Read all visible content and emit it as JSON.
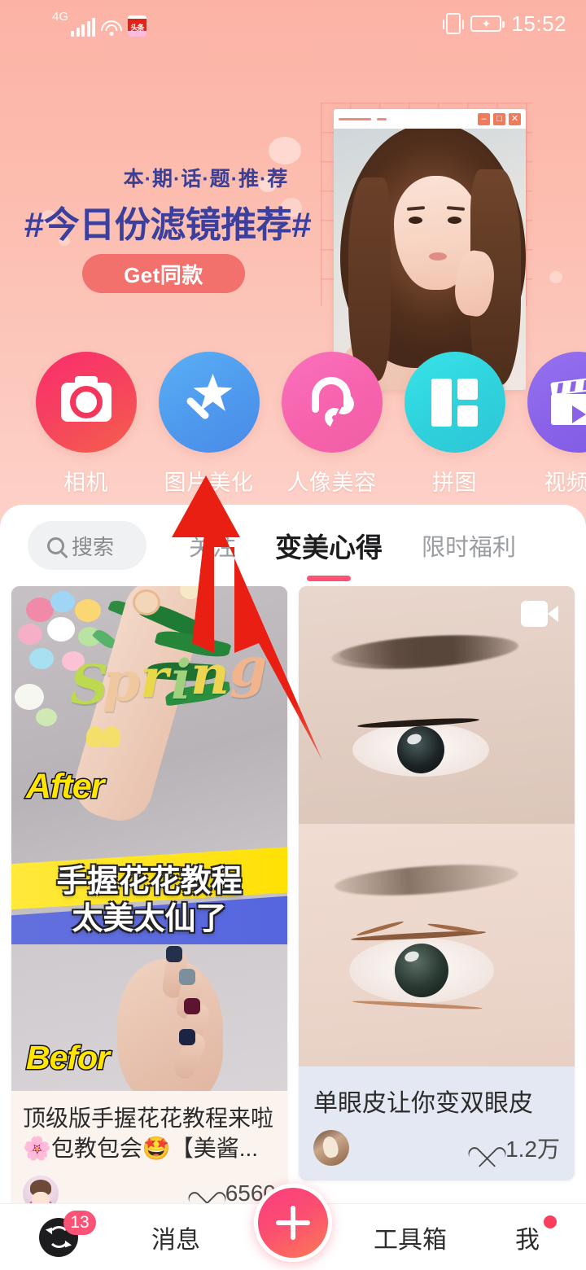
{
  "status_bar": {
    "network": "4G",
    "signal_icon": "signal-bars-icon",
    "wifi_icon": "wifi-icon",
    "app_icon": "toutiao-app-icon",
    "app_icon_text": "头条",
    "vibrate_icon": "vibrate-icon",
    "battery_icon": "battery-charging-icon",
    "time": "15:52"
  },
  "banner": {
    "subtitle": "本·期·话·题·推·荐",
    "title": "#今日份滤镜推荐#",
    "cta_label": "Get同款",
    "window_controls": [
      "–",
      "□",
      "✕"
    ],
    "accent_color": "#3b3f9e",
    "cta_color": "#f2716d"
  },
  "shortcuts": [
    {
      "label": "相机",
      "icon": "camera-icon",
      "color": "#f5365c"
    },
    {
      "label": "图片美化",
      "icon": "magic-wand-icon",
      "color": "#52a0ef"
    },
    {
      "label": "人像美容",
      "icon": "hair-beauty-icon",
      "color": "#f濃"
    },
    {
      "label": "拼图",
      "icon": "collage-grid-icon",
      "color": "#2fd6de"
    },
    {
      "label": "视频美",
      "icon": "video-clapper-icon",
      "color": "#8a63e8"
    }
  ],
  "search": {
    "placeholder": "搜索",
    "icon": "search-icon"
  },
  "tabs": [
    {
      "label": "关注",
      "active": false
    },
    {
      "label": "变美心得",
      "active": true
    },
    {
      "label": "限时福利",
      "active": false
    }
  ],
  "feed": {
    "left_card": {
      "image_labels": {
        "after": "After",
        "before": "Befor",
        "word_art": "Spring"
      },
      "image_overlay_line1": "手握花花教程",
      "image_overlay_line2": "太美太仙了",
      "title": "顶级版手握花花教程来啦🌸包教包会🤩【美酱...",
      "likes": "6560",
      "like_icon": "heart-icon",
      "avatar": "avatar-cartoon-girl"
    },
    "right_card": {
      "video_icon": "video-camera-icon",
      "title": "单眼皮让你变双眼皮",
      "likes": "1.2万",
      "like_icon": "heart-icon",
      "avatar": "avatar-photo"
    }
  },
  "bottom_nav": [
    {
      "label": "",
      "icon": "refresh-icon",
      "badge": "13"
    },
    {
      "label": "消息",
      "icon": "",
      "badge": ""
    },
    {
      "label": "",
      "icon": "plus-icon",
      "badge": ""
    },
    {
      "label": "工具箱",
      "icon": "",
      "badge": ""
    },
    {
      "label": "我",
      "icon": "",
      "badge": "dot"
    }
  ],
  "annotation": {
    "type": "red-arrow",
    "color": "#e81f12",
    "points_to": "图片美化"
  }
}
